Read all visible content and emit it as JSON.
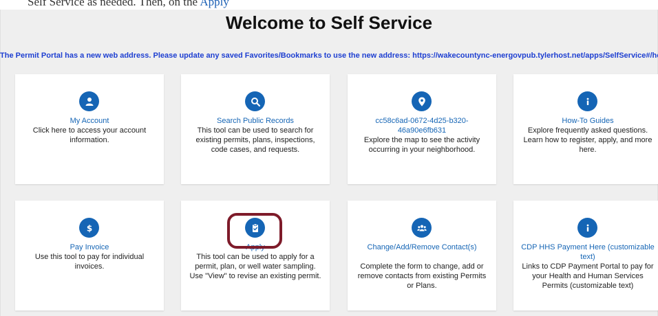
{
  "top_strip": {
    "text": "Self Service as needed. Then, on the ",
    "link": "Apply"
  },
  "header": {
    "title": "Welcome to Self Service",
    "notice": "The Permit Portal has a new web address. Please update any saved Favorites/Bookmarks to use the new address: https://wakecountync-energovpub.tylerhost.net/apps/SelfService#/home"
  },
  "cards": [
    {
      "icon": "user-icon",
      "title": "My Account",
      "desc": "Click here to access your account information."
    },
    {
      "icon": "search-icon",
      "title": "Search Public Records",
      "desc": "This tool can be used to search for existing permits, plans, inspections, code cases, and requests."
    },
    {
      "icon": "map-marker-icon",
      "title": "cc58c6ad-0672-4d25-b320-46a90e6fb631",
      "desc": "Explore the map to see the activity occurring in your neighborhood."
    },
    {
      "icon": "info-icon",
      "title": "How-To Guides",
      "desc": "Explore frequently asked questions. Learn how to register, apply, and more here."
    },
    {
      "icon": "dollar-icon",
      "title": "Pay Invoice",
      "desc": "Use this tool to pay for individual invoices."
    },
    {
      "icon": "clipboard-check-icon",
      "title": "Apply",
      "desc": "This tool can be used to apply for a permit, plan, or well water sampling. Use \"View\" to revise an existing permit."
    },
    {
      "icon": "users-icon",
      "title": "Change/Add/Remove Contact(s)",
      "desc": "Complete the form to change, add or remove contacts from existing Permits or Plans."
    },
    {
      "icon": "info-icon",
      "title": "CDP HHS Payment Here (customizable text)",
      "desc": "Links to CDP Payment Portal to pay for your Health and Human Services Permits (customizable text)"
    }
  ],
  "colors": {
    "accent": "#1565b5",
    "notice": "#1e3fd1",
    "highlight": "#7e1b2a"
  }
}
